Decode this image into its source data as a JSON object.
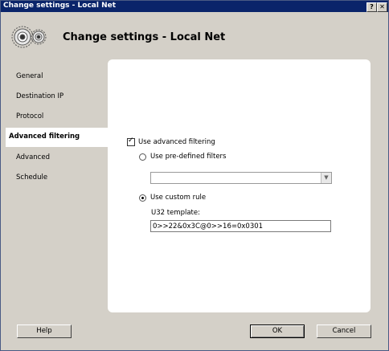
{
  "window": {
    "title": "Change settings - Local Net",
    "help_glyph": "?",
    "close_glyph": "✕"
  },
  "header": {
    "title": "Change settings - Local Net",
    "icon": "gears-icon"
  },
  "nav": {
    "items": [
      {
        "label": "General"
      },
      {
        "label": "Destination IP"
      },
      {
        "label": "Protocol"
      },
      {
        "label": "Advanced filtering",
        "active": true
      },
      {
        "label": "Advanced"
      },
      {
        "label": "Schedule"
      }
    ]
  },
  "filtering": {
    "use_advanced_label": "Use advanced filtering",
    "use_advanced_checked": true,
    "predefined_label": "Use pre-defined filters",
    "predefined_selected": false,
    "predefined_value": "",
    "custom_label": "Use custom rule",
    "custom_selected": true,
    "template_label": "U32 template:",
    "template_value": "0>>22&0x3C@0>>16=0x0301"
  },
  "buttons": {
    "help": "Help",
    "ok": "OK",
    "cancel": "Cancel"
  }
}
